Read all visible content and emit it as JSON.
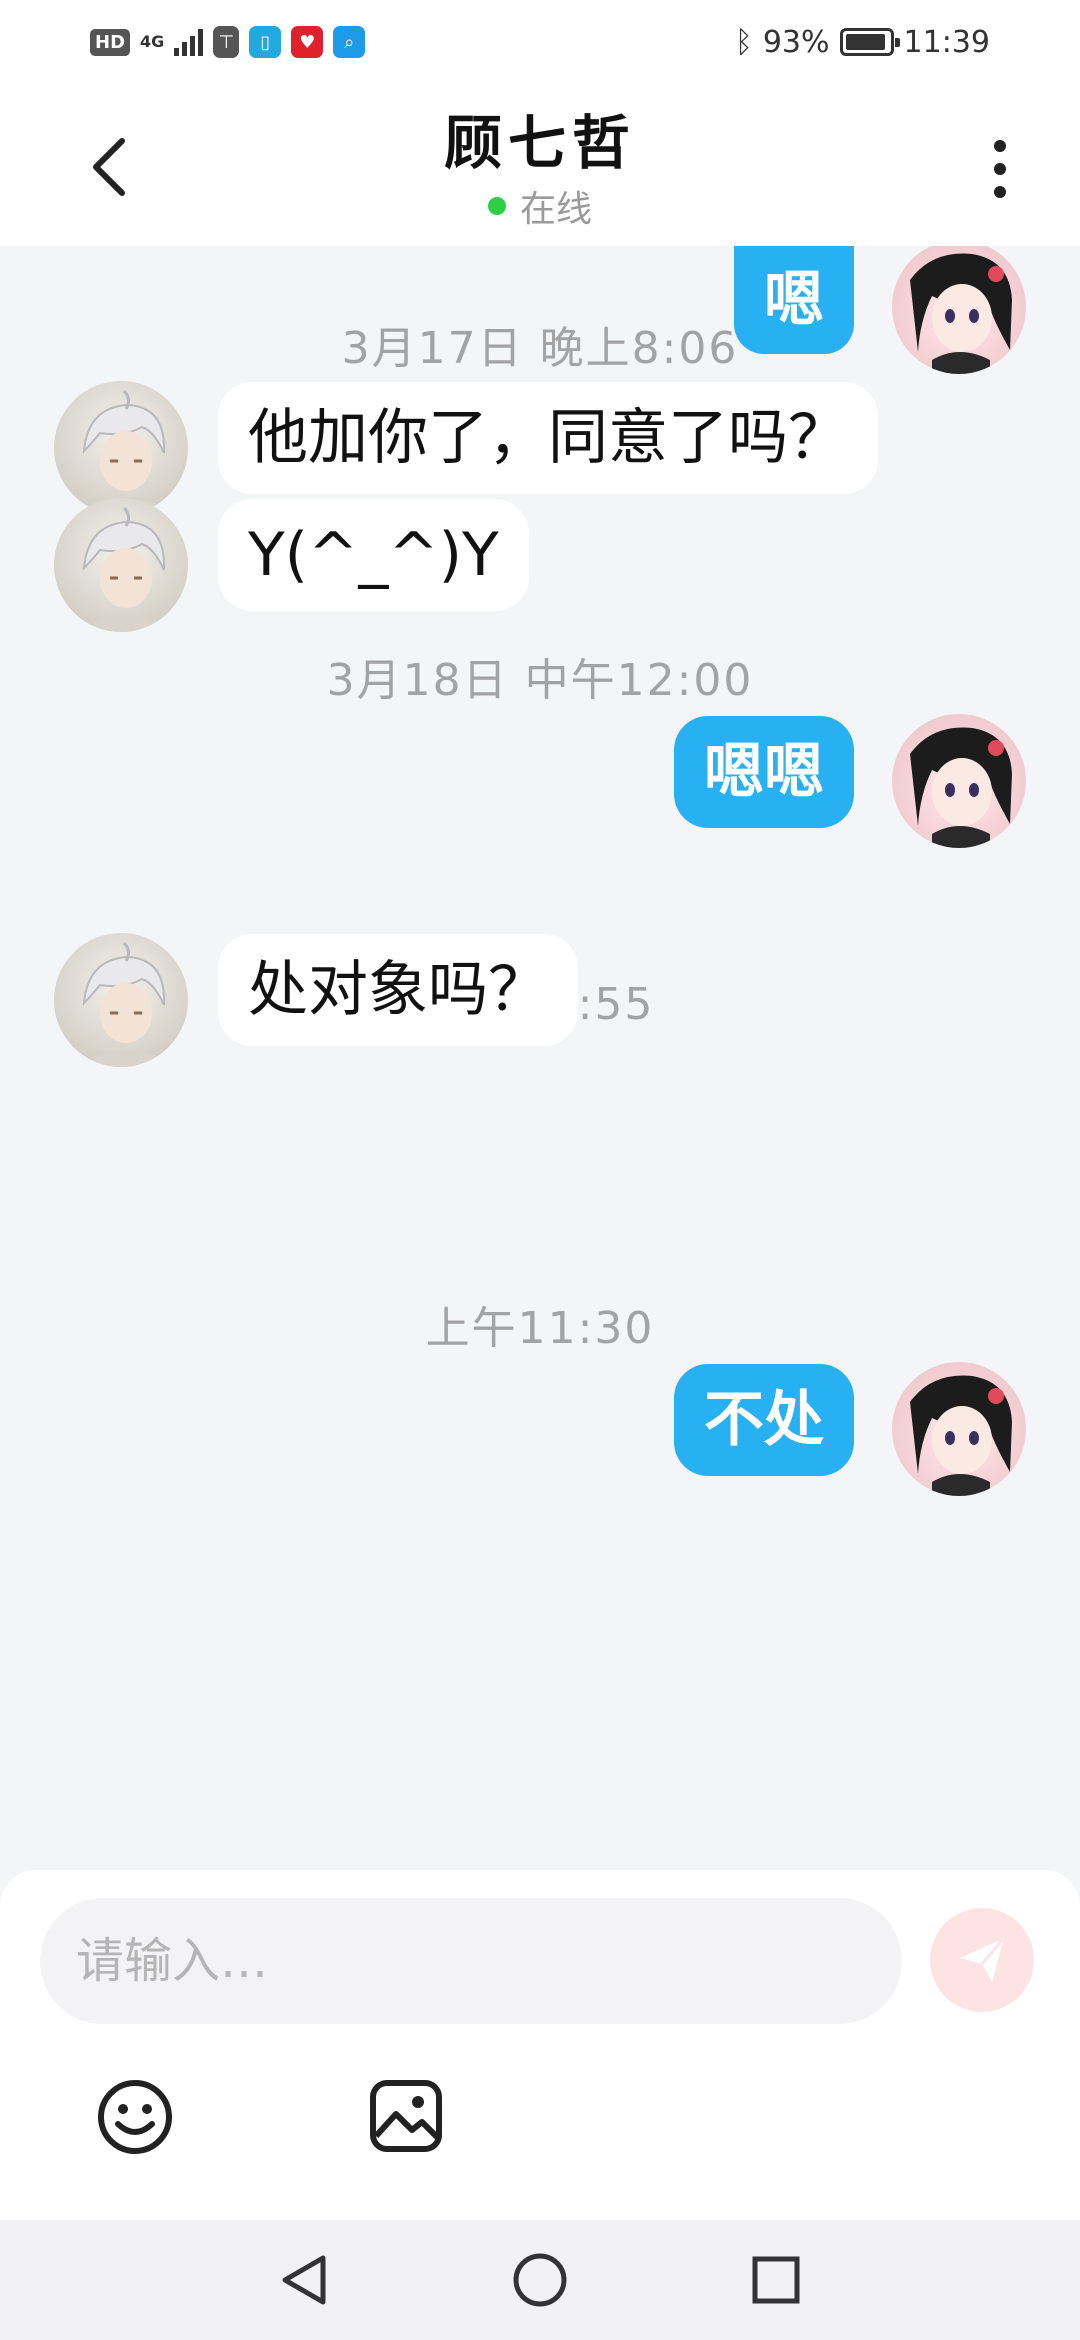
{
  "status_bar": {
    "network": "4G",
    "hd": "HD",
    "battery": "93%",
    "time": "11:39",
    "battery_level": 0.93
  },
  "header": {
    "title": "顾七哲",
    "status": "在线"
  },
  "messages": [
    {
      "type": "bubble",
      "side": "me",
      "text": "嗯"
    },
    {
      "type": "timestamp",
      "text": "3月17日 晚上8:06"
    },
    {
      "type": "bubble",
      "side": "them",
      "text": "他加你了，同意了吗？"
    },
    {
      "type": "bubble",
      "side": "them",
      "text": "Y(^_^)Y"
    },
    {
      "type": "timestamp",
      "text": "3月18日 中午12:00"
    },
    {
      "type": "bubble",
      "side": "me",
      "text": "嗯嗯"
    },
    {
      "type": "timestamp",
      "text": "上午10:55"
    },
    {
      "type": "bubble",
      "side": "them",
      "text": "处对象吗？"
    },
    {
      "type": "timestamp",
      "text": "上午11:30"
    },
    {
      "type": "bubble",
      "side": "me",
      "text": "不处"
    }
  ],
  "input": {
    "placeholder": "请输入…",
    "value": ""
  },
  "icons": {
    "back": "chevron-left-icon",
    "more": "more-vertical-icon",
    "send": "paper-plane-icon",
    "emoji": "smiley-icon",
    "image": "image-icon",
    "nav_back": "triangle-back-icon",
    "nav_home": "circle-home-icon",
    "nav_recent": "square-recent-icon"
  },
  "colors": {
    "accent": "#27b1f2",
    "online": "#2fcf45",
    "send_button": "#fde3e3"
  }
}
